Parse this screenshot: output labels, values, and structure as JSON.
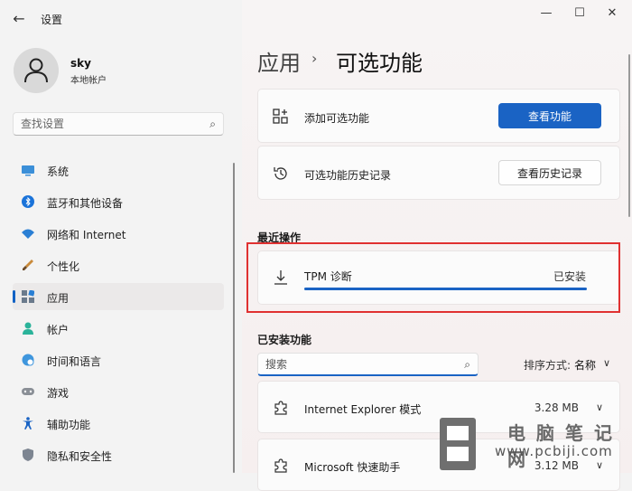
{
  "window": {
    "title": "设置",
    "back": "←",
    "minimize": "—",
    "maximize": "☐",
    "close": "✕"
  },
  "profile": {
    "name": "sky",
    "account_type": "本地帐户"
  },
  "search": {
    "placeholder": "查找设置"
  },
  "sidebar": {
    "items": [
      {
        "label": "系统",
        "icon": "monitor-icon"
      },
      {
        "label": "蓝牙和其他设备",
        "icon": "bluetooth-icon"
      },
      {
        "label": "网络和 Internet",
        "icon": "wifi-icon"
      },
      {
        "label": "个性化",
        "icon": "brush-icon"
      },
      {
        "label": "应用",
        "icon": "apps-icon",
        "active": true
      },
      {
        "label": "帐户",
        "icon": "person-icon"
      },
      {
        "label": "时间和语言",
        "icon": "globe-clock-icon"
      },
      {
        "label": "游戏",
        "icon": "gamepad-icon"
      },
      {
        "label": "辅助功能",
        "icon": "accessibility-icon"
      },
      {
        "label": "隐私和安全性",
        "icon": "shield-icon"
      }
    ]
  },
  "header": {
    "parent": "应用",
    "separator": "›",
    "title": "可选功能"
  },
  "cards": {
    "add": {
      "label": "添加可选功能",
      "button": "查看功能"
    },
    "history": {
      "label": "可选功能历史记录",
      "button": "查看历史记录"
    }
  },
  "recent": {
    "title": "最近操作",
    "item": {
      "name": "TPM 诊断",
      "status": "已安装",
      "progress": 1.0
    }
  },
  "installed": {
    "title": "已安装功能",
    "search_placeholder": "搜索",
    "sort_label": "排序方式:",
    "sort_value": "名称",
    "features": [
      {
        "name": "Internet Explorer 模式",
        "size": "3.28 MB"
      },
      {
        "name": "Microsoft 快速助手",
        "size": "3.12 MB"
      }
    ]
  },
  "watermark": {
    "title": "电脑笔记网",
    "url": "www.pcbiji.com"
  },
  "colors": {
    "accent": "#1a63c4",
    "highlight": "#e03131"
  }
}
